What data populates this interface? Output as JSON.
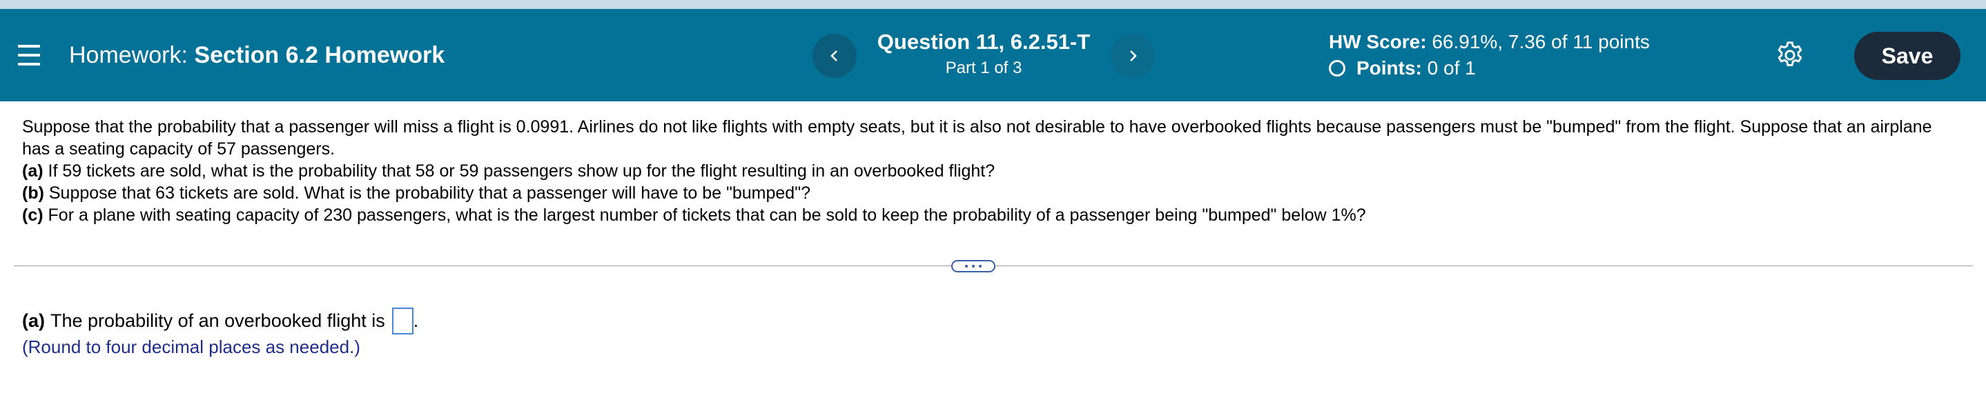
{
  "header": {
    "menu_icon": "hamburger-icon",
    "homework_prefix": "Homework:",
    "homework_name": "Section 6.2 Homework",
    "question_title": "Question 11, 6.2.51-T",
    "part_label": "Part 1 of 3",
    "prev_icon": "chevron-left-icon",
    "next_icon": "chevron-right-icon",
    "hw_score_label": "HW Score:",
    "hw_score_value": "66.91%, 7.36 of 11 points",
    "points_label": "Points:",
    "points_value": "0 of 1",
    "settings_icon": "gear-icon",
    "save_label": "Save"
  },
  "problem": {
    "intro": "Suppose that the probability that a passenger will miss a flight is 0.0991. Airlines do not like flights with empty seats, but it is also not desirable to have overbooked flights because passengers must be \"bumped\" from the flight. Suppose that an airplane has a seating capacity of 57 passengers.",
    "parts": [
      {
        "label": "(a)",
        "text": "If 59 tickets are sold, what is the probability that 58 or 59 passengers show up for the flight resulting in an overbooked flight?"
      },
      {
        "label": "(b)",
        "text": "Suppose that 63 tickets are sold. What is the probability that a passenger will have to be \"bumped\"?"
      },
      {
        "label": "(c)",
        "text": "For a plane with seating capacity of 230 passengers, what is the largest number of tickets that can be sold to keep the probability of a passenger being \"bumped\" below 1%?"
      }
    ]
  },
  "answer": {
    "label": "(a)",
    "text": "The probability of an overbooked flight is",
    "value": "",
    "suffix": ".",
    "note": "(Round to four decimal places as needed.)"
  },
  "colors": {
    "header_bg": "#047297",
    "save_bg": "#1b2b3c",
    "note_text": "#1f2d8a",
    "input_border": "#4a86d6"
  }
}
